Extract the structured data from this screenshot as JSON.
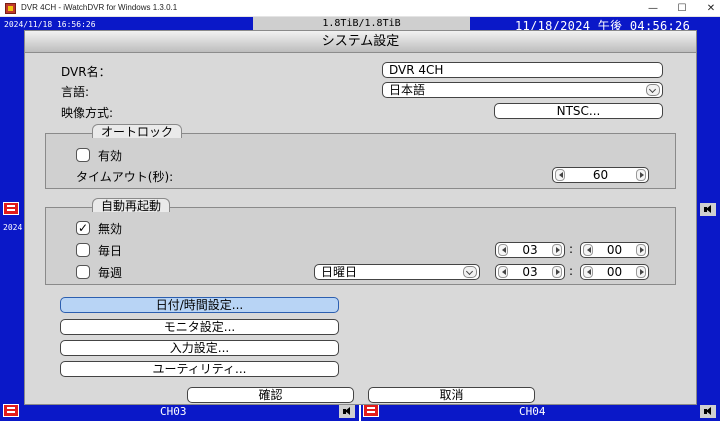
{
  "window": {
    "title": "DVR 4CH - iWatchDVR for Windows 1.3.0.1",
    "minimize": "—",
    "maximize": "☐",
    "close": "✕"
  },
  "osd": {
    "timestamp_left": "2024/11/18 16:56:26",
    "hdd_usage": "1.8TiB/1.8TiB",
    "timestamp_right": "11/18/2024 午後 04:56:26",
    "side_year": "2024",
    "channel_bottom_left": "CH03",
    "channel_bottom_right": "CH04"
  },
  "dialog": {
    "title": "システム設定",
    "dvr_name_label": "DVR名：",
    "dvr_name_value": "DVR 4CH",
    "language_label": "言語:",
    "language_value": "日本語",
    "video_format_label": "映像方式:",
    "video_format_value": "NTSC..."
  },
  "autolock": {
    "title": "オートロック",
    "enable_label": "有効",
    "enable_checked": false,
    "timeout_label": "タイムアウト(秒):",
    "timeout_value": "60"
  },
  "auto_reboot": {
    "title": "自動再起動",
    "disabled_label": "無効",
    "daily_label": "毎日",
    "weekly_label": "毎週",
    "weekday_value": "日曜日",
    "daily_hour": "03",
    "daily_minute": "00",
    "weekly_hour": "03",
    "weekly_minute": "00",
    "time_separator": ":",
    "check_mark": "✓"
  },
  "buttons": {
    "datetime": "日付/時間設定...",
    "monitor": "モニタ設定...",
    "input": "入力設定...",
    "utility": "ユーティリティ...",
    "ok": "確認",
    "cancel": "取消"
  }
}
